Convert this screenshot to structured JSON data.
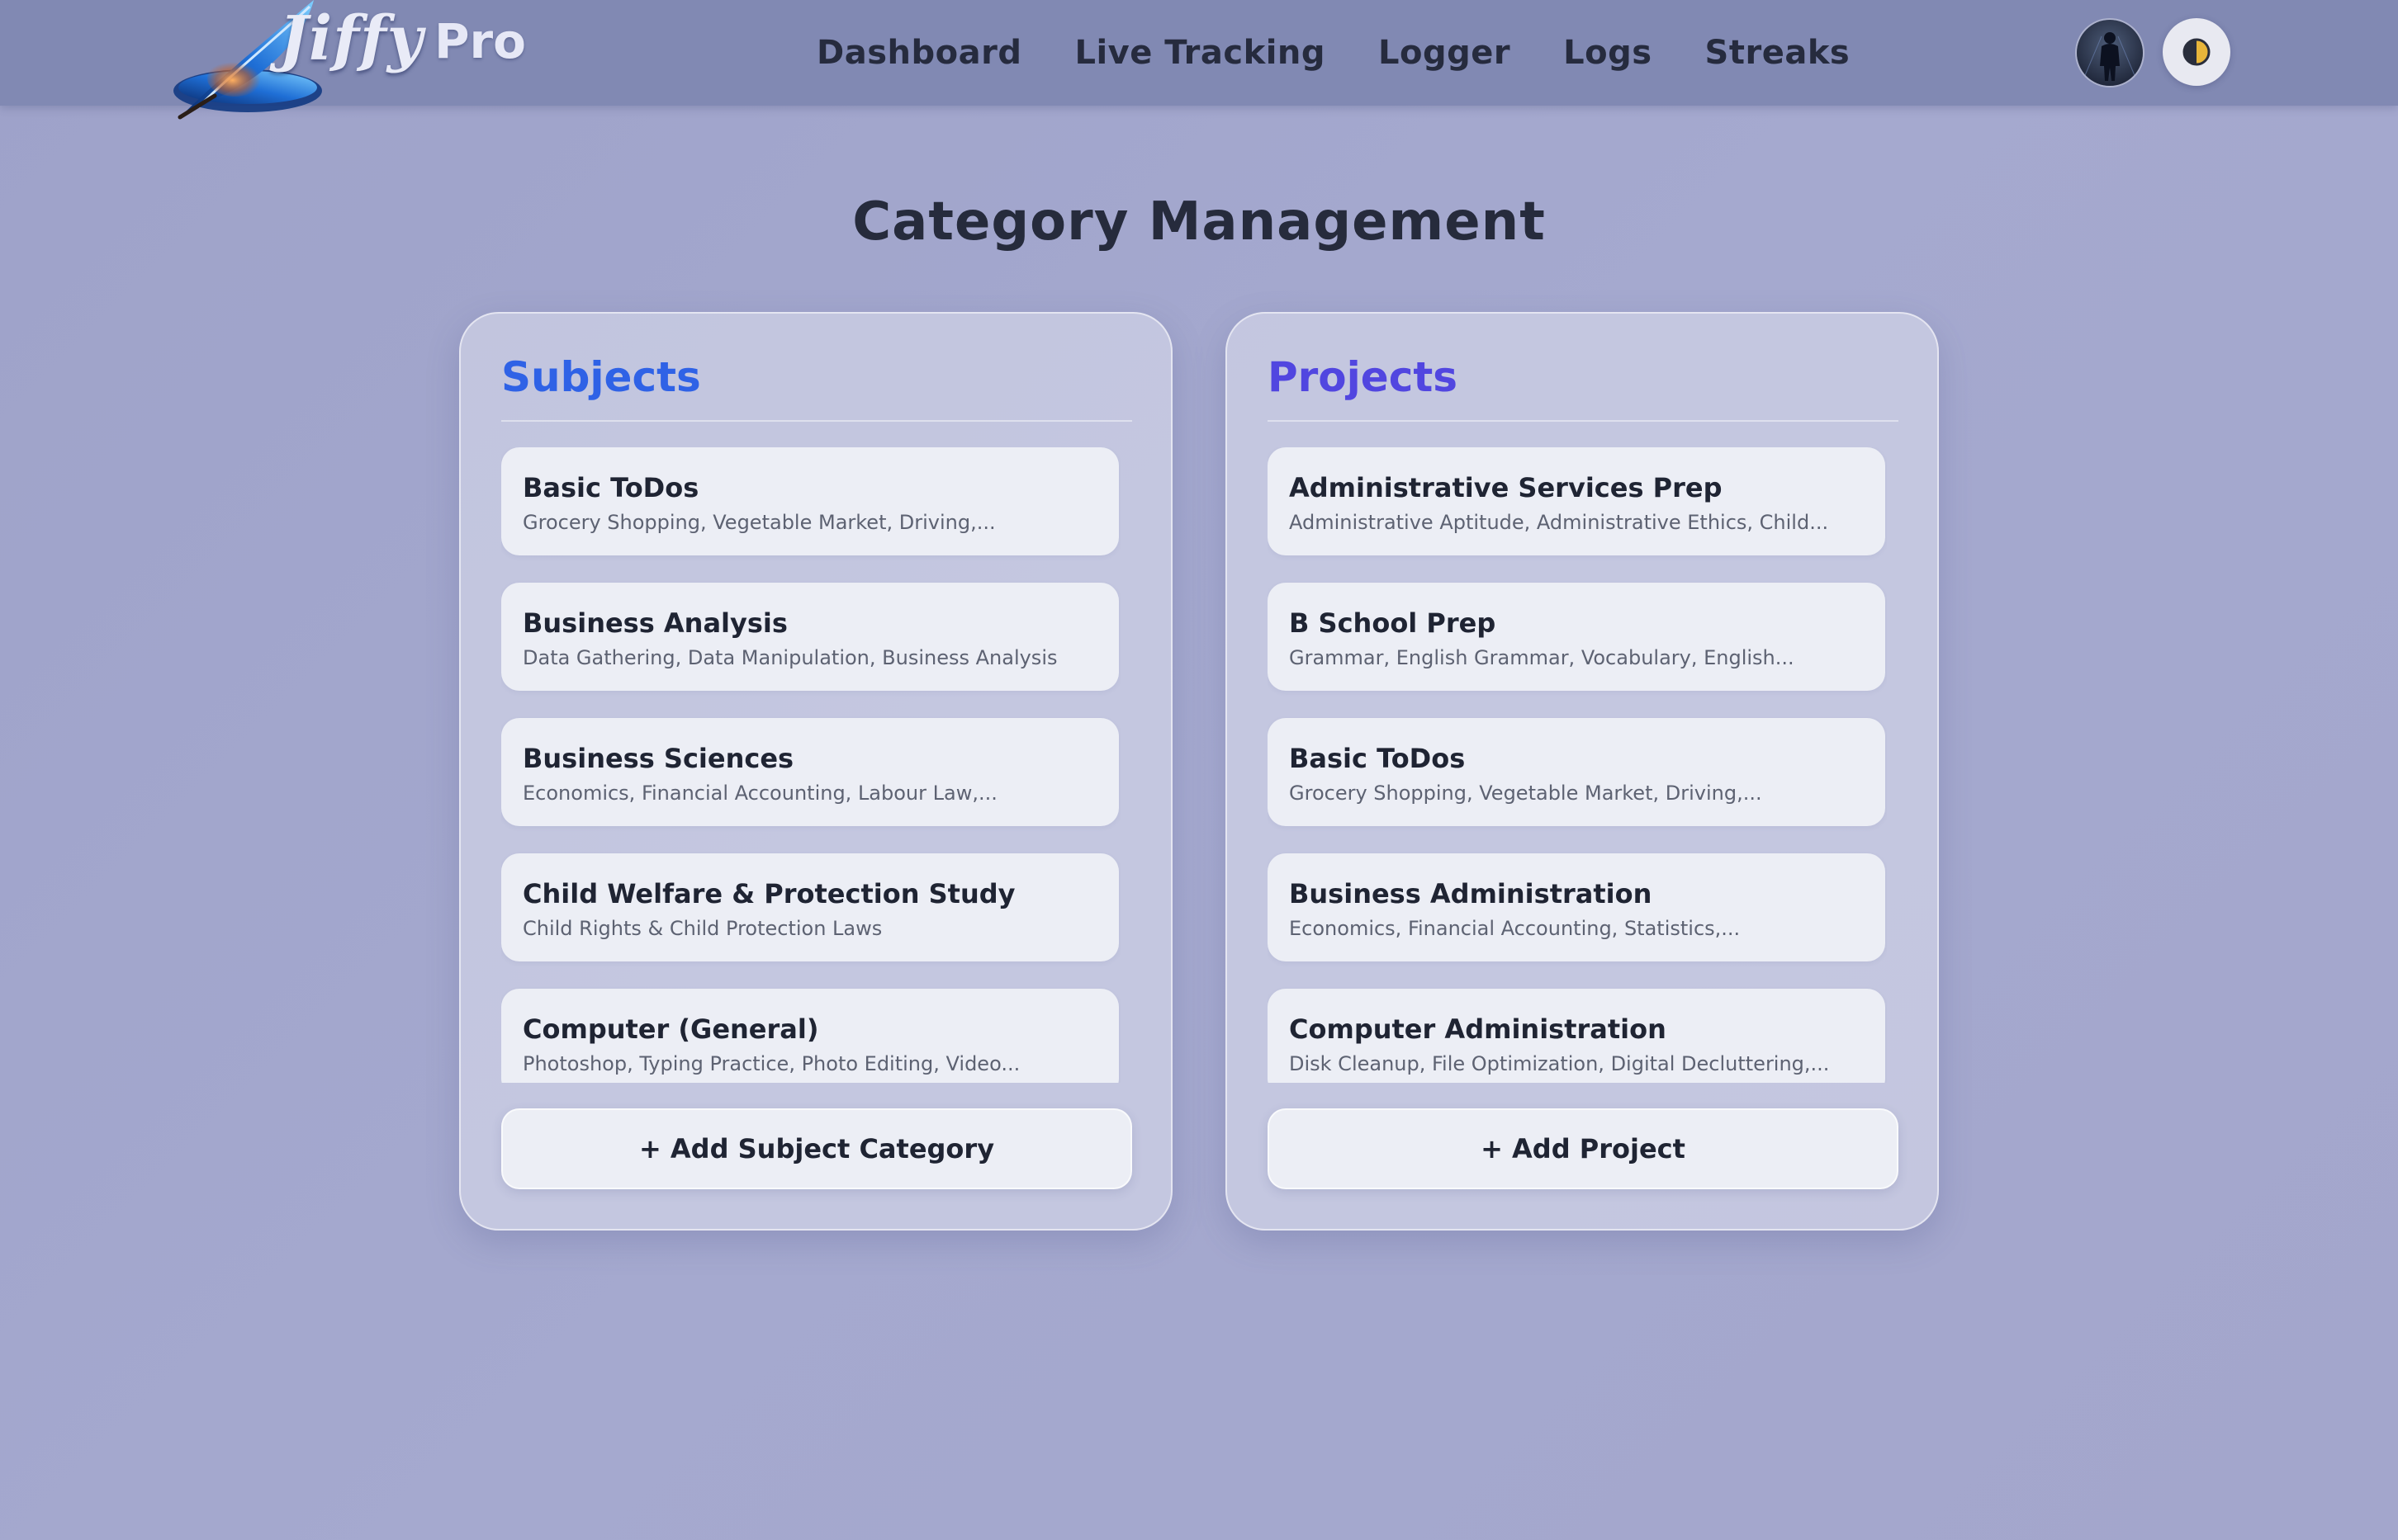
{
  "app": {
    "brand_name": "Jiffy",
    "brand_tier": "Pro"
  },
  "nav": {
    "links": [
      "Dashboard",
      "Live Tracking",
      "Logger",
      "Logs",
      "Streaks"
    ]
  },
  "header_icons": {
    "avatar": "user-avatar",
    "theme_toggle": "half-moon-icon"
  },
  "main": {
    "title": "Category Management"
  },
  "subjects": {
    "title": "Subjects",
    "title_color": "#2f62e6",
    "items": [
      {
        "name": "Basic ToDos",
        "desc": "Grocery Shopping, Vegetable Market, Driving,..."
      },
      {
        "name": "Business Analysis",
        "desc": "Data Gathering, Data Manipulation, Business Analysis"
      },
      {
        "name": "Business Sciences",
        "desc": "Economics, Financial Accounting, Labour Law,..."
      },
      {
        "name": "Child Welfare & Protection Study",
        "desc": "Child Rights & Child Protection Laws"
      },
      {
        "name": "Computer (General)",
        "desc": "Photoshop, Typing Practice, Photo Editing, Video..."
      }
    ],
    "add_label": "+ Add Subject Category"
  },
  "projects": {
    "title": "Projects",
    "title_color": "#5146e0",
    "items": [
      {
        "name": "Administrative Services Prep",
        "desc": "Administrative Aptitude, Administrative Ethics, Child..."
      },
      {
        "name": "B School Prep",
        "desc": "Grammar, English Grammar, Vocabulary, English..."
      },
      {
        "name": "Basic ToDos",
        "desc": "Grocery Shopping, Vegetable Market, Driving,..."
      },
      {
        "name": "Business Administration",
        "desc": "Economics, Financial Accounting, Statistics,..."
      },
      {
        "name": "Computer Administration",
        "desc": "Disk Cleanup, File Optimization, Digital Decluttering,..."
      }
    ],
    "add_label": "+ Add Project"
  }
}
